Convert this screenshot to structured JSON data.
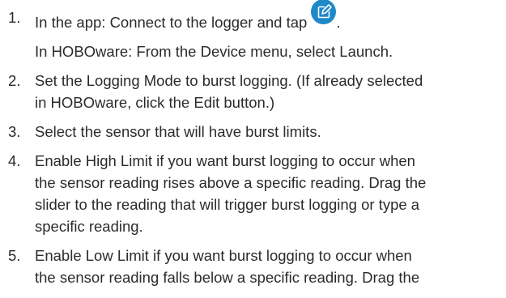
{
  "steps": [
    {
      "number": "1.",
      "line1_before_icon": "In the app: Connect to the logger and tap",
      "icon": "edit-icon",
      "line1_after_icon": ".",
      "subline": "In HOBOware: From the Device menu, select Launch."
    },
    {
      "number": "2.",
      "lines": [
        "Set the Logging Mode to burst logging. (If already selected",
        "in HOBOware, click the Edit button.)"
      ]
    },
    {
      "number": "3.",
      "lines": [
        "Select the sensor that will have burst limits."
      ]
    },
    {
      "number": "4.",
      "lines": [
        "Enable High Limit if you want burst logging to occur when",
        "the sensor reading rises above a specific reading. Drag the",
        "slider to the reading that will trigger burst logging or type a",
        "specific reading."
      ]
    },
    {
      "number": "5.",
      "lines": [
        "Enable Low Limit if you want burst logging to occur when",
        "the sensor reading falls below a specific reading. Drag the"
      ]
    }
  ],
  "colors": {
    "text": "#2b2b2b",
    "icon_bg": "#1f88c9",
    "icon_fg": "#ffffff"
  }
}
